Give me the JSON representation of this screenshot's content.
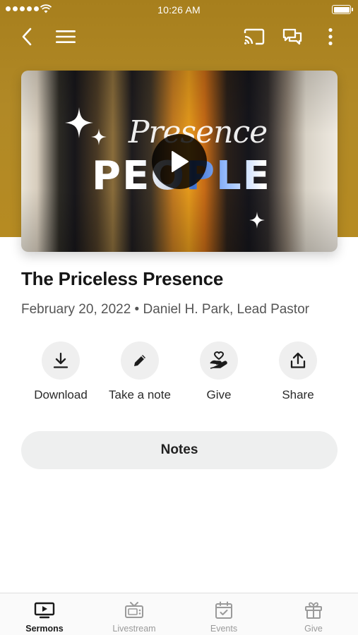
{
  "status_bar": {
    "time": "10:26 AM"
  },
  "nav": {
    "back_icon": "chevron-left-icon",
    "menu_icon": "hamburger-menu-icon",
    "cast_icon": "cast-icon",
    "chat_icon": "chat-icon",
    "more_icon": "more-vertical-icon"
  },
  "hero": {
    "script_text": "Presence",
    "word_text": "PEOPLE",
    "play_icon": "play-icon"
  },
  "sermon": {
    "title": "The Priceless Presence",
    "meta": "February 20, 2022 • Daniel H. Park, Lead Pastor"
  },
  "actions": [
    {
      "label": "Download",
      "icon": "download-icon"
    },
    {
      "label": "Take a note",
      "icon": "pencil-icon"
    },
    {
      "label": "Give",
      "icon": "heart-hand-icon"
    },
    {
      "label": "Share",
      "icon": "share-icon"
    }
  ],
  "notes": {
    "label": "Notes"
  },
  "tabs": [
    {
      "label": "Sermons",
      "icon": "tv-play-icon",
      "active": true
    },
    {
      "label": "Livestream",
      "icon": "tv-icon",
      "active": false
    },
    {
      "label": "Events",
      "icon": "calendar-check-icon",
      "active": false
    },
    {
      "label": "Give",
      "icon": "gift-icon",
      "active": false
    }
  ],
  "colors": {
    "header": "#b0861f",
    "tab_active": "#1b1b1b",
    "tab_inactive": "#9a9a9a"
  }
}
